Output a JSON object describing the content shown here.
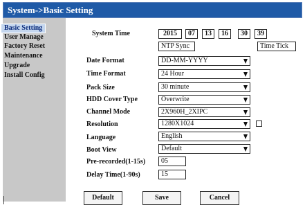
{
  "title": "System->Basic Setting",
  "nav": [
    "Basic Setting",
    "User Manage",
    "Factory Reset",
    "Maintenance",
    "Upgrade",
    "Install Config"
  ],
  "system_time": {
    "label": "System Time",
    "year": "2015",
    "month": "07",
    "day": "13",
    "hour": "16",
    "minute": "30",
    "second": "39",
    "ntp_label": "NTP Sync",
    "time_tick_label": "Time Tick"
  },
  "fields": {
    "date_format": {
      "label": "Date Format",
      "value": "DD-MM-YYYY"
    },
    "time_format": {
      "label": "Time Format",
      "value": "24 Hour"
    },
    "pack_size": {
      "label": "Pack Size",
      "value": "30 minute"
    },
    "hdd_cover": {
      "label": "HDD Cover Type",
      "value": "Overwrite"
    },
    "channel_mode": {
      "label": "Channel Mode",
      "value": "2X960H_2XIPC"
    },
    "resolution": {
      "label": "Resolution",
      "value": "1280X1024"
    },
    "language": {
      "label": "Language",
      "value": "English"
    },
    "boot_view": {
      "label": "Boot View",
      "value": "Default"
    },
    "pre_recorded": {
      "label": "Pre-recorded(1-15s)",
      "value": "05"
    },
    "delay_time": {
      "label": "Delay Time(1-90s)",
      "value": "15"
    }
  },
  "buttons": {
    "default": "Default",
    "save": "Save",
    "cancel": "Cancel"
  },
  "colors": {
    "title_bar": "#1f5aa7",
    "sidebar": "#c8c8c8",
    "selected_nav": "#c4d6ee"
  }
}
